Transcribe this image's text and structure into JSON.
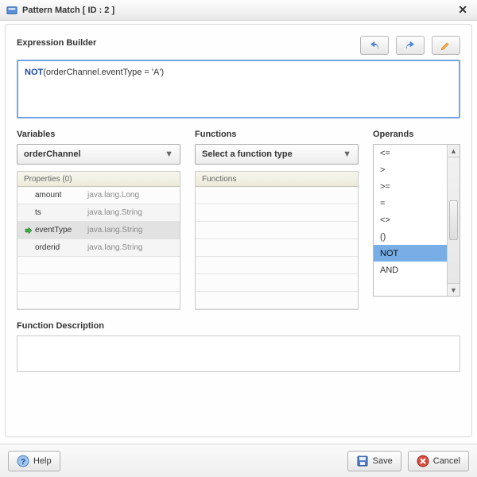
{
  "window": {
    "title": "Pattern Match [ ID : 2 ]"
  },
  "expression": {
    "label": "Expression Builder",
    "keyword": "NOT",
    "rest": "(orderChannel.eventType = 'A')"
  },
  "variables": {
    "label": "Variables",
    "combo": "orderChannel",
    "grid_header": "Properties (0)",
    "rows": [
      {
        "name": "amount",
        "type": "java.lang.Long",
        "selected": false
      },
      {
        "name": "ts",
        "type": "java.lang.String",
        "selected": false
      },
      {
        "name": "eventType",
        "type": "java.Iang.String",
        "selected": true
      },
      {
        "name": "orderid",
        "type": "java.Iang.String",
        "selected": false
      }
    ]
  },
  "functions": {
    "label": "Functions",
    "combo": "Select a function type",
    "grid_header": "Functions"
  },
  "operands": {
    "label": "Operands",
    "items": [
      "<=",
      ">",
      ">=",
      "=",
      "<>",
      "()",
      "NOT",
      "AND"
    ],
    "selected_index": 6
  },
  "func_desc": {
    "label": "Function Description"
  },
  "footer": {
    "help": "Help",
    "save": "Save",
    "cancel": "Cancel"
  }
}
